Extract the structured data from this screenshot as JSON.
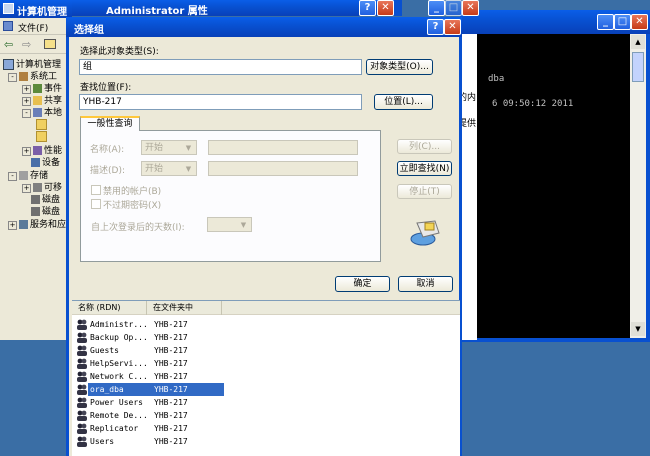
{
  "bg_window": {
    "title": "计算机管理",
    "menu": {
      "file": "文件(F)"
    },
    "tree": [
      {
        "label": "计算机管理",
        "indent": 0
      },
      {
        "label": "系统工",
        "indent": 1
      },
      {
        "label": "事件",
        "indent": 2
      },
      {
        "label": "共享",
        "indent": 2
      },
      {
        "label": "本地",
        "indent": 2
      },
      {
        "label": "",
        "indent": 3
      },
      {
        "label": "",
        "indent": 3
      },
      {
        "label": "性能",
        "indent": 2
      },
      {
        "label": "设备",
        "indent": 2
      },
      {
        "label": "存储",
        "indent": 1
      },
      {
        "label": "可移",
        "indent": 2
      },
      {
        "label": "磁盘",
        "indent": 2
      },
      {
        "label": "磁盘",
        "indent": 2
      },
      {
        "label": "服务和应",
        "indent": 1
      }
    ]
  },
  "props_window": {
    "title": "Administrator 属性"
  },
  "console": {
    "lines": [
      "dba",
      "6 09:50:12 2011"
    ],
    "side_text": [
      "的内",
      "提供"
    ]
  },
  "dialog": {
    "title": "选择组",
    "object_type_label": "选择此对象类型(S):",
    "object_type_value": "组",
    "object_type_button": "对象类型(O)...",
    "location_label": "查找位置(F):",
    "location_value": "YHB-217",
    "location_button": "位置(L)...",
    "tab_label": "一般性查询",
    "name_label": "名称(A):",
    "name_mode": "开始",
    "desc_label": "描述(D):",
    "desc_mode": "开始",
    "disabled_accounts": "禁用的帐户(B)",
    "non_expiring": "不过期密码(X)",
    "days_label": "自上次登录后的天数(I):",
    "columns_button": "列(C)...",
    "find_now_button": "立即查找(N)",
    "stop_button": "停止(T)",
    "ok_button": "确定",
    "cancel_button": "取消",
    "results": {
      "headers": [
        "名称 (RDN)",
        "在文件夹中"
      ],
      "rows": [
        {
          "name": "Administr...",
          "folder": "YHB-217"
        },
        {
          "name": "Backup Op...",
          "folder": "YHB-217"
        },
        {
          "name": "Guests",
          "folder": "YHB-217"
        },
        {
          "name": "HelpServi...",
          "folder": "YHB-217"
        },
        {
          "name": "Network C...",
          "folder": "YHB-217"
        },
        {
          "name": "ora_dba",
          "folder": "YHB-217",
          "selected": true
        },
        {
          "name": "Power Users",
          "folder": "YHB-217"
        },
        {
          "name": "Remote De...",
          "folder": "YHB-217"
        },
        {
          "name": "Replicator",
          "folder": "YHB-217"
        },
        {
          "name": "Users",
          "folder": "YHB-217"
        }
      ]
    }
  },
  "colors": {
    "desktop": "#3a6ea5",
    "xp_title": "#0850d0",
    "dialog_face": "#ece9d8",
    "selection": "#316ac5",
    "console_bg": "#000000"
  }
}
